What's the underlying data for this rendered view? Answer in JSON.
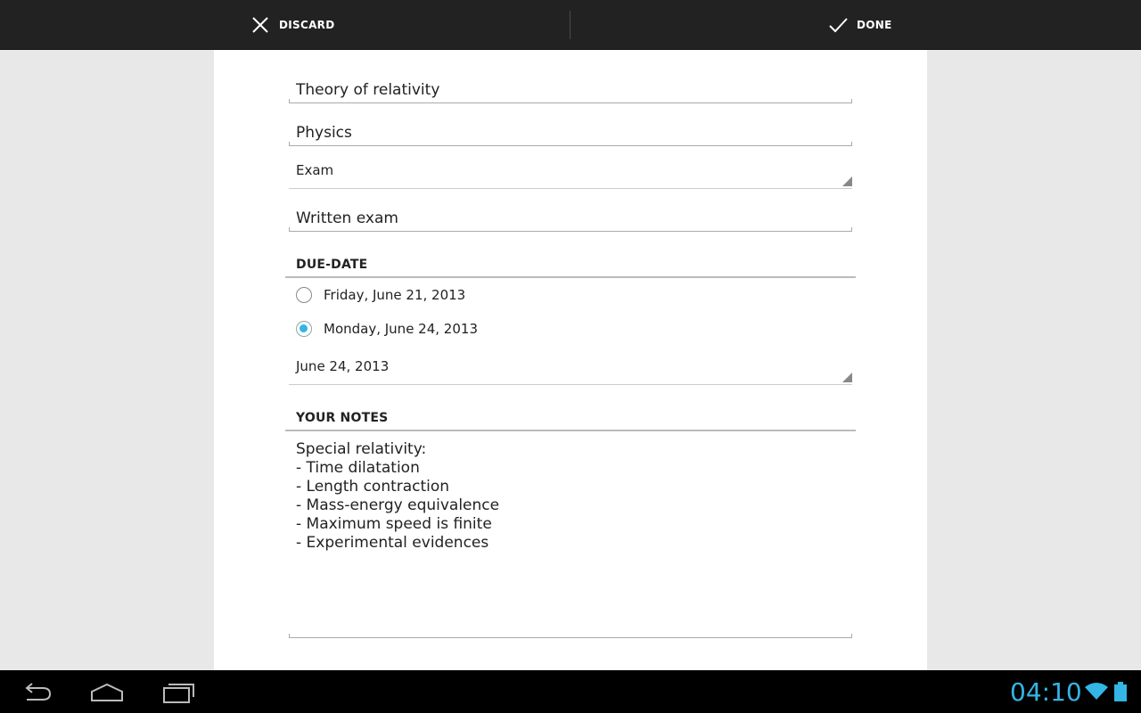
{
  "action_bar": {
    "discard_label": "DISCARD",
    "done_label": "DONE",
    "discard_icon": "close-icon",
    "done_icon": "check-icon"
  },
  "form": {
    "title_value": "Theory of relativity",
    "subject_value": "Physics",
    "kind_selected": "Exam",
    "description_value": "Written exam",
    "due_date": {
      "header": "DUE-DATE",
      "options": [
        {
          "label": "Friday, June 21, 2013",
          "checked": false
        },
        {
          "label": "Monday, June 24, 2013",
          "checked": true
        }
      ],
      "picker_value": "June 24, 2013"
    },
    "notes": {
      "header": "YOUR NOTES",
      "text": "Special relativity:\n- Time dilatation\n- Length contraction\n- Mass-energy equivalence\n- Maximum speed is finite\n- Experimental evidences"
    }
  },
  "system_bar": {
    "clock": "04:10",
    "accent_color": "#33b5e5",
    "icons": [
      "back-icon",
      "home-icon",
      "recent-apps-icon",
      "wifi-icon",
      "battery-icon"
    ]
  }
}
